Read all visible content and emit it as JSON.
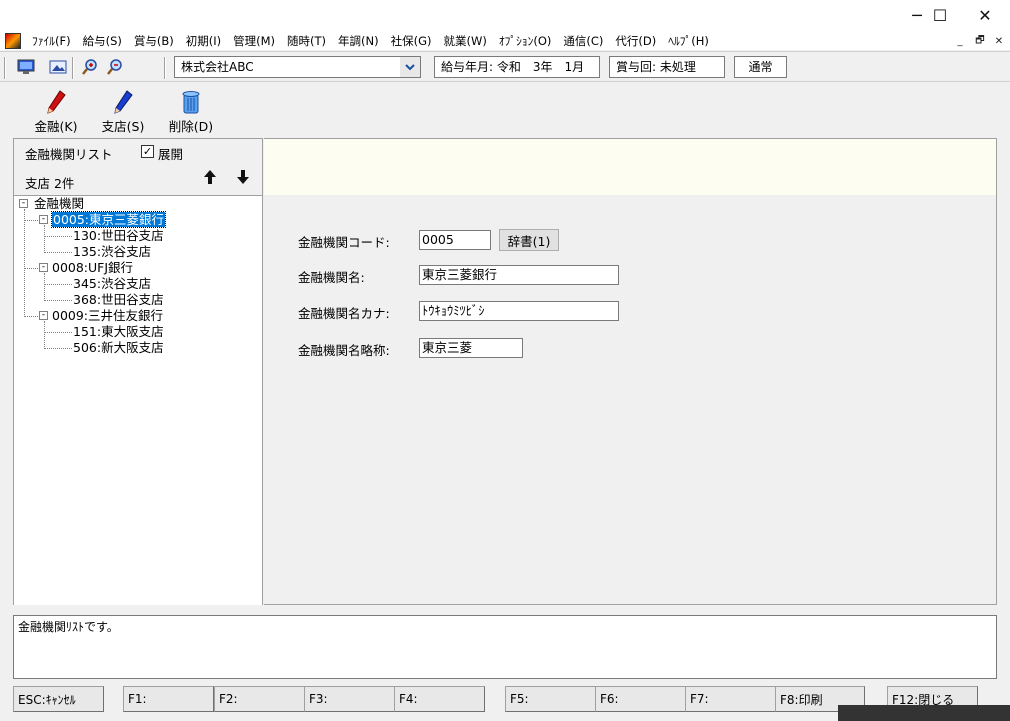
{
  "window": {
    "minimize": "─",
    "maximize": "☐",
    "close": "✕"
  },
  "menu": [
    "ﾌｧｲﾙ(F)",
    "給与(S)",
    "賞与(B)",
    "初期(I)",
    "管理(M)",
    "随時(T)",
    "年調(N)",
    "社保(G)",
    "就業(W)",
    "ｵﾌﾟｼｮﾝ(O)",
    "通信(C)",
    "代行(D)",
    "ﾍﾙﾌﾟ(H)"
  ],
  "mdi_controls": {
    "minimize": "_",
    "restore": "🗗",
    "close": "✕"
  },
  "toolbar": {
    "company": "株式会社ABC",
    "pay_period": "給与年月: 令和　3年　1月",
    "bonus": "賞与回: 未処理",
    "mode": "通常"
  },
  "actions": [
    {
      "label": "金融(K)",
      "icon": "red-pen-icon",
      "color": "#d01010"
    },
    {
      "label": "支店(S)",
      "icon": "blue-pen-icon",
      "color": "#1a3fcf"
    },
    {
      "label": "削除(D)",
      "icon": "trash-icon",
      "color": "#1a6fd0"
    }
  ],
  "left_panel": {
    "title": "金融機関リスト",
    "expand_label": "展開",
    "expand_checked": "✓",
    "count_label": "支店 2件",
    "up_arrow": "🡅",
    "down_arrow": "🡇"
  },
  "tree": {
    "root": "金融機関",
    "banks": [
      {
        "label": "0005:東京三菱銀行",
        "selected": true,
        "branches": [
          "130:世田谷支店",
          "135:渋谷支店"
        ]
      },
      {
        "label": "0008:UFJ銀行",
        "selected": false,
        "branches": [
          "345:渋谷支店",
          "368:世田谷支店"
        ]
      },
      {
        "label": "0009:三井住友銀行",
        "selected": false,
        "branches": [
          "151:東大阪支店",
          "506:新大阪支店"
        ]
      }
    ]
  },
  "form": {
    "code_label": "金融機関コード:",
    "code_value": "0005",
    "dict_button": "辞書(1)",
    "name_label": "金融機関名:",
    "name_value": "東京三菱銀行",
    "kana_label": "金融機関名カナ:",
    "kana_value": "ﾄｳｷｮｳﾐﾂﾋﾞｼ",
    "short_label": "金融機関名略称:",
    "short_value": "東京三菱"
  },
  "message": "金融機関ﾘｽﾄです。",
  "function_keys": [
    "ESC:ｷｬﾝｾﾙ",
    "F1:",
    "F2:",
    "F3:",
    "F4:",
    "F5:",
    "F6:",
    "F7:",
    "F8:印刷",
    "F12:閉じる"
  ]
}
